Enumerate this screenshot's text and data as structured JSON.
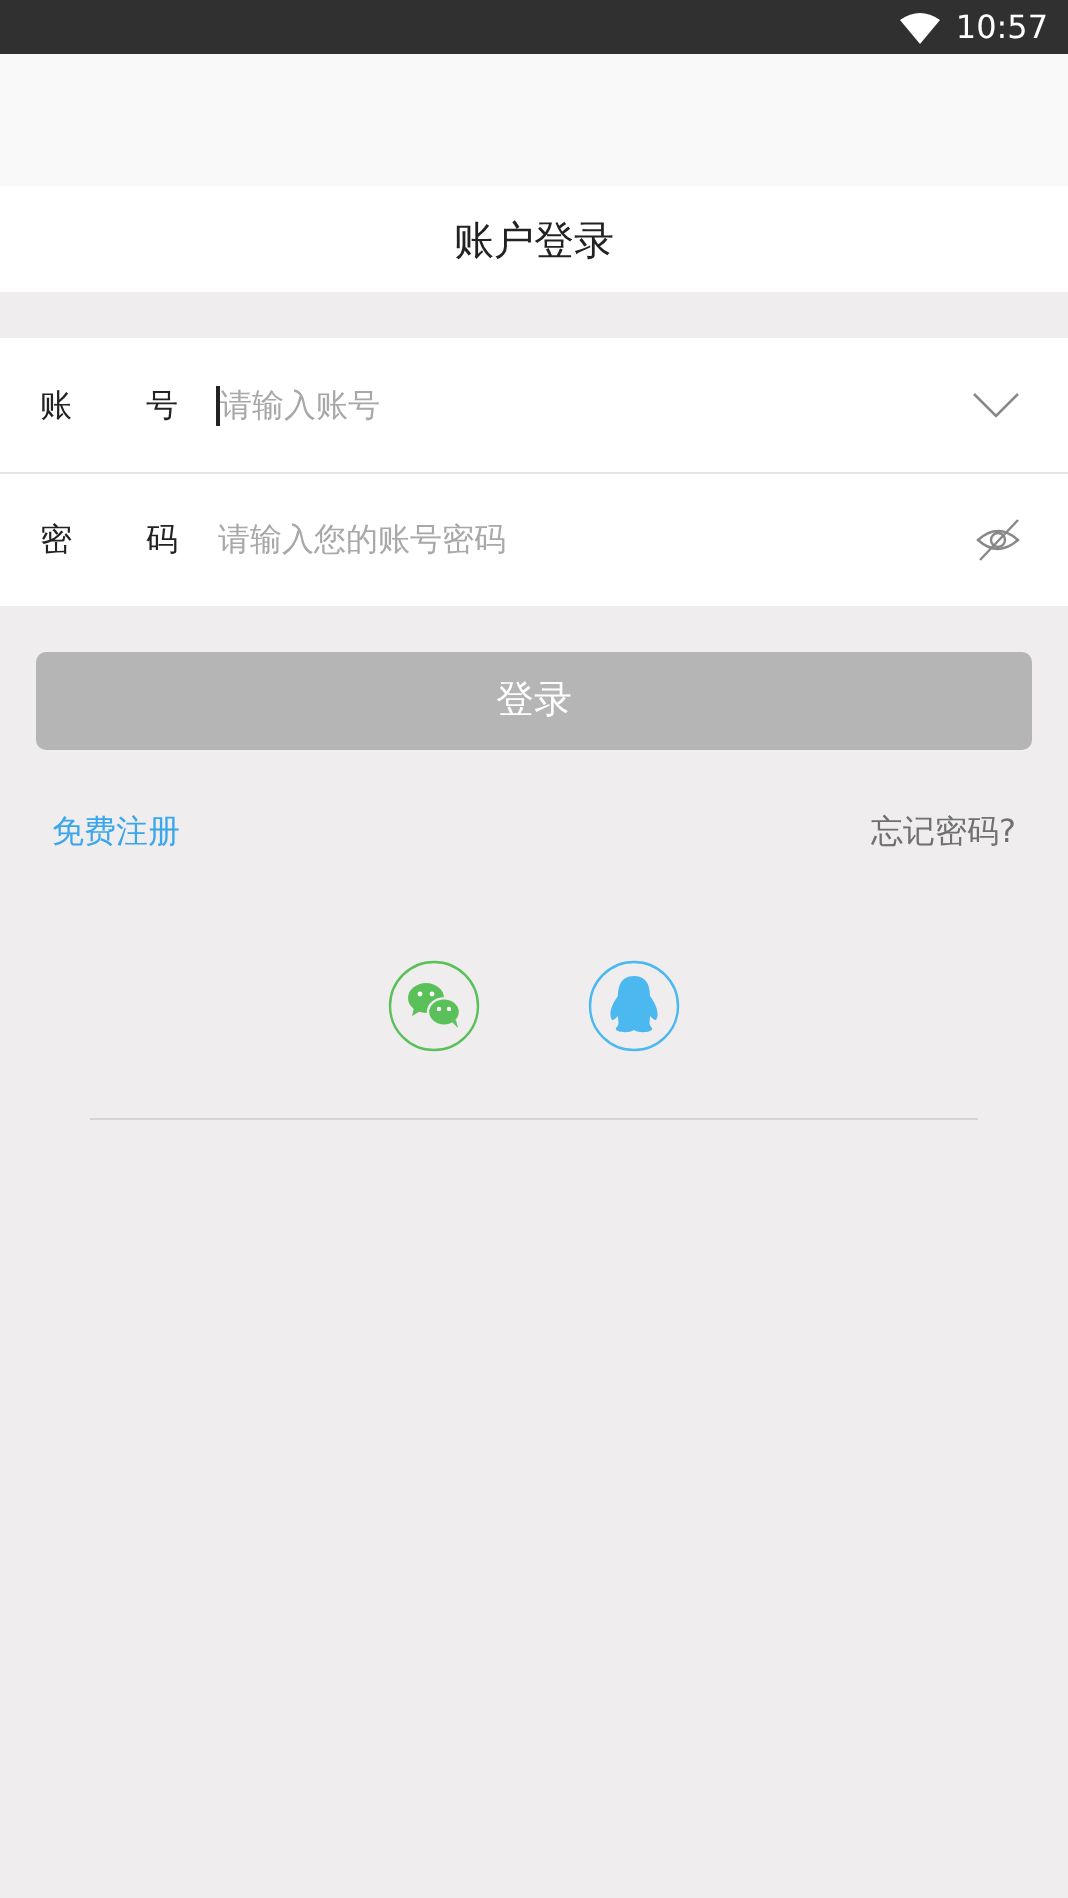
{
  "status_bar": {
    "time": "10:57"
  },
  "header": {
    "title": "账户登录"
  },
  "fields": [
    {
      "kind": "account",
      "label": "账 号",
      "placeholder": "请输入账号",
      "focused": true
    },
    {
      "kind": "password",
      "label": "密 码",
      "placeholder": "请输入您的账号密码",
      "focused": false
    }
  ],
  "login_button": {
    "label": "登录",
    "disabled": true
  },
  "links": {
    "register": "免费注册",
    "forgot": "忘记密码?"
  },
  "social": [
    {
      "kind": "wechat",
      "color": "#5ac05a"
    },
    {
      "kind": "qq",
      "color": "#4cb8f0"
    }
  ]
}
